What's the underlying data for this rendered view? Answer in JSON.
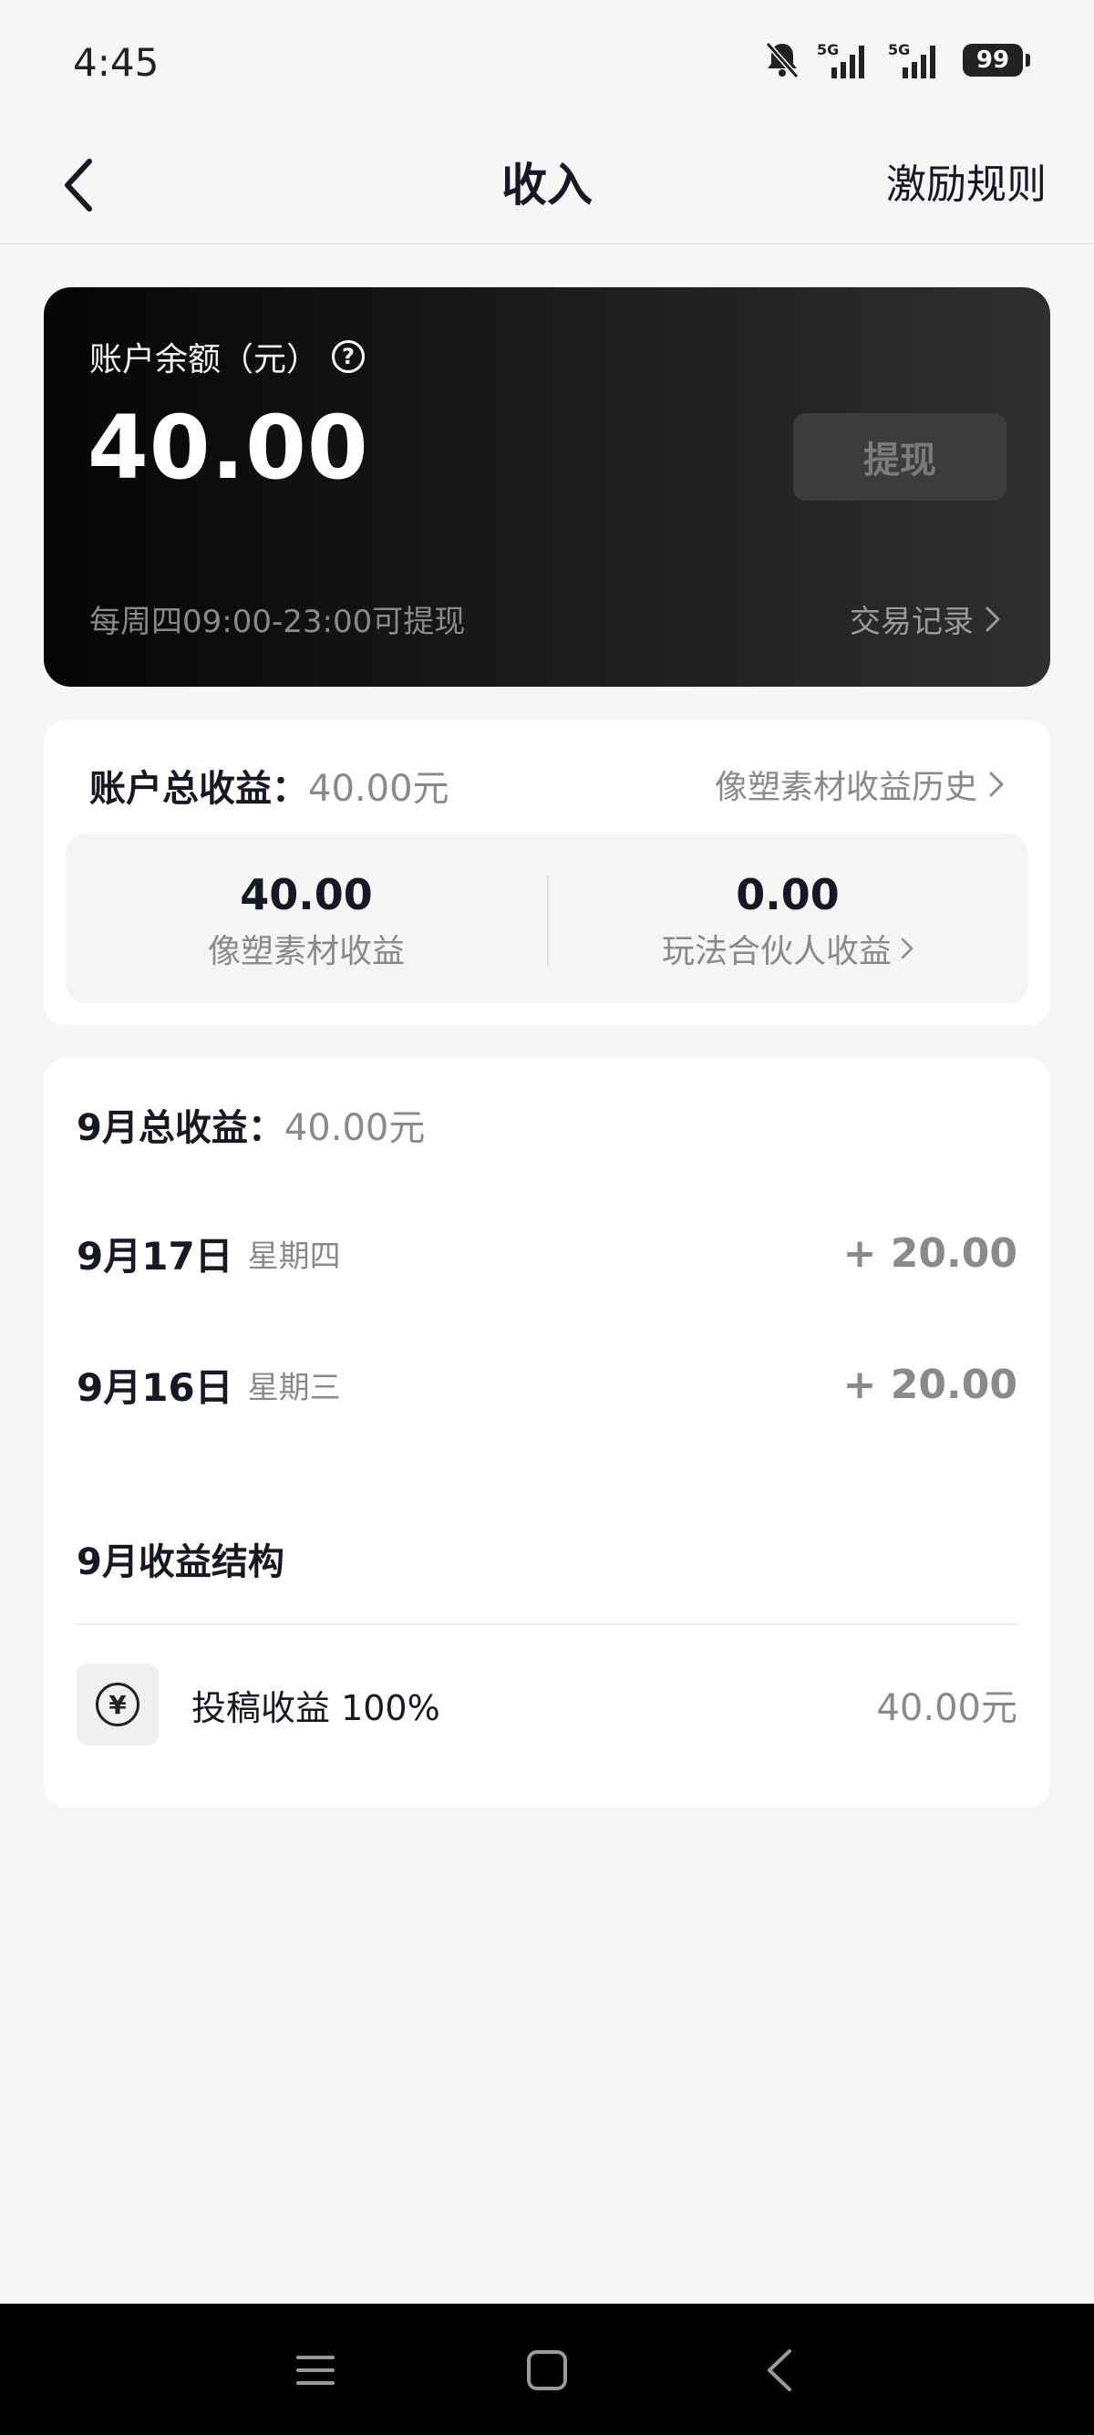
{
  "status_bar": {
    "time": "4:45",
    "network_1": "5G",
    "network_2": "5G",
    "battery": "99"
  },
  "nav": {
    "title": "收入",
    "action": "激励规则"
  },
  "balance": {
    "label": "账户余额（元）",
    "amount": "40.00",
    "withdraw_label": "提现",
    "withdraw_note": "每周四09:00-23:00可提现",
    "transactions_link": "交易记录"
  },
  "earnings": {
    "total_label": "账户总收益：",
    "total_value": "40.00元",
    "history_link": "像塑素材收益历史",
    "stats": [
      {
        "value": "40.00",
        "label": "像塑素材收益"
      },
      {
        "value": "0.00",
        "label": "玩法合伙人收益"
      }
    ]
  },
  "monthly": {
    "total_label": "9月总收益：",
    "total_value": "40.00元",
    "days": [
      {
        "date": "9月17日",
        "weekday": "星期四",
        "amount": "+ 20.00"
      },
      {
        "date": "9月16日",
        "weekday": "星期三",
        "amount": "+ 20.00"
      }
    ],
    "structure_title": "9月收益结构",
    "structure": [
      {
        "icon": "yen-icon",
        "label": "投稿收益 100%",
        "value": "40.00元"
      }
    ]
  },
  "colors": {
    "card_dark": "#1d1d1d",
    "text_primary": "#161823",
    "text_secondary": "#8a8a8a",
    "background": "#f6f6f6"
  }
}
